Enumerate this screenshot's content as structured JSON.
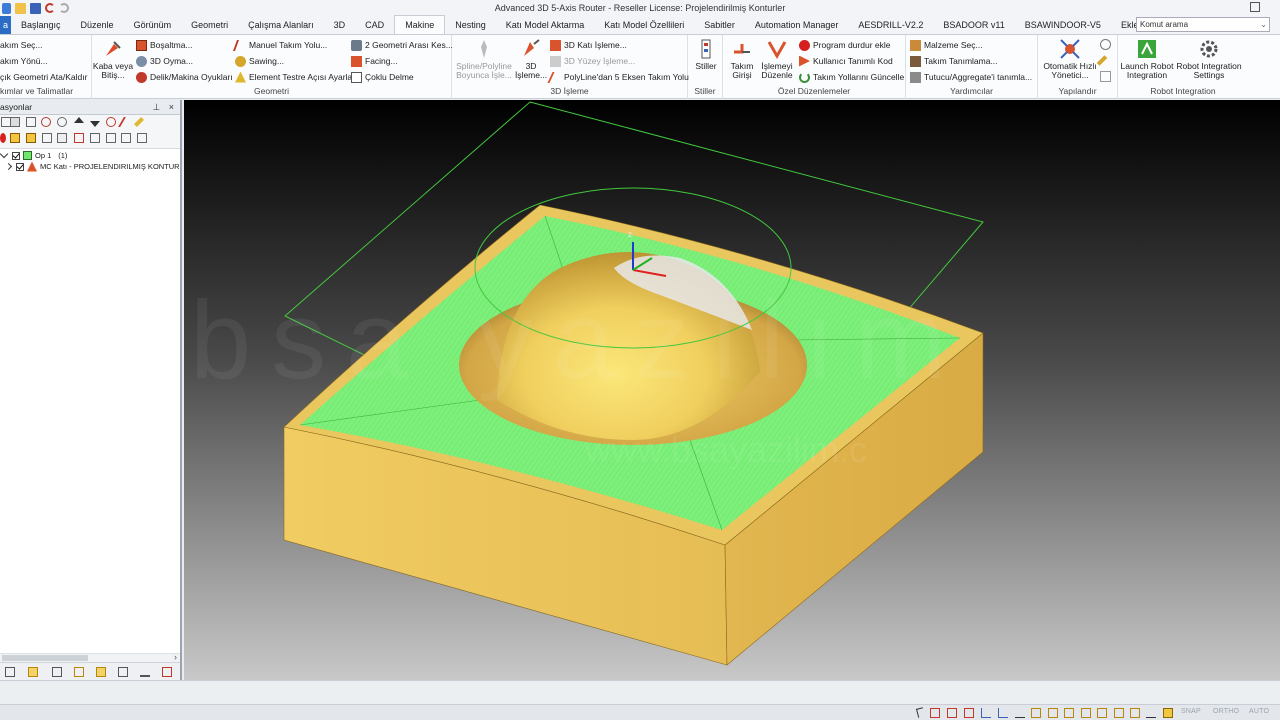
{
  "window": {
    "title": "Advanced 3D 5-Axis Router - Reseller License: Projelendirilmiş Konturler"
  },
  "tabs": [
    {
      "label": "a",
      "kind": "file"
    },
    {
      "label": "Başlangıç"
    },
    {
      "label": "Düzenle"
    },
    {
      "label": "Görünüm"
    },
    {
      "label": "Geometri"
    },
    {
      "label": "Çalışma Alanları"
    },
    {
      "label": "3D"
    },
    {
      "label": "CAD"
    },
    {
      "label": "Makine",
      "active": true
    },
    {
      "label": "Nesting"
    },
    {
      "label": "Katı Model Aktarma"
    },
    {
      "label": "Katı Model Özellileri"
    },
    {
      "label": "Sabitler"
    },
    {
      "label": "Automation Manager"
    },
    {
      "label": "AESDRILL-V2.2"
    },
    {
      "label": "BSADOOR v11"
    },
    {
      "label": "BSAWINDOOR-V5"
    },
    {
      "label": "Eklentiler/Makrolar"
    }
  ],
  "command_search": {
    "placeholder": "Komut arama"
  },
  "ribbon": {
    "group1": {
      "items": [
        "akım Seç...",
        "akım Yönü...",
        "çık Geometri Ata/Kaldır"
      ],
      "label": "kımlar ve Talimatlar"
    },
    "geometri": {
      "big_button": "Kaba veya\nBitiş...",
      "col1": [
        "Boşaltma...",
        "3D Oyma...",
        "Delik/Makina Oyukları"
      ],
      "col2": [
        "Manuel Takım Yolu...",
        "Sawing...",
        "Element Testre Açısı Ayarla"
      ],
      "col3": [
        "2 Geometri Arası Kes...",
        "Facing...",
        "Çoklu Delme"
      ],
      "label": "Geometri"
    },
    "islem3d": {
      "big1": "Spline/Polyline\nBoyunca İşle...",
      "big2": "3D\nİşleme...",
      "col": [
        "3D Katı İşleme...",
        "3D Yüzey İşleme...",
        "PolyLine'dan 5 Eksen Takım Yolu"
      ],
      "label": "3D İşleme"
    },
    "stiller": {
      "big": "Stiller",
      "label": "Stiller"
    },
    "ozel": {
      "big1": "Takım\nGirişi",
      "big2": "İşlemeyi\nDüzenle",
      "col": [
        "Program durdur ekle",
        "Kullanıcı Tanımlı Kod",
        "Takım Yollarını Güncelle"
      ],
      "label": "Özel Düzenlemeler"
    },
    "yardimcilar": {
      "col": [
        "Malzeme Seç...",
        "Takım Tanımlama...",
        "Tutucu/Aggregate'i tanımla..."
      ],
      "label": "Yardımcılar"
    },
    "yapilandir": {
      "big": "Otomatik Hızlı\nYönetici...",
      "label": "Yapılandır"
    },
    "robot": {
      "big1": "Launch Robot\nIntegration",
      "big2": "Robot Integration\nSettings",
      "label": "Robot Integration"
    }
  },
  "left_panel": {
    "title": "asyonlar",
    "pin": "⊥",
    "close": "×",
    "tree": [
      {
        "label": "Op 1",
        "extra": "(1)"
      },
      {
        "label": "MC Katı - PROJELENDIRILMIŞ KONTUR"
      }
    ]
  },
  "viewport": {
    "watermark": "bsa yazılım",
    "watermark_url": "www.bsayazilim.c",
    "axis_label": "z"
  },
  "status_bar": {
    "snap": "SNAP",
    "ortho": "ORTHO",
    "auto": "AUTO"
  },
  "colors": {
    "ribbon_active_tab": "#fbfcfd",
    "file_tab": "#2b6cc4",
    "part_body": "#e6c25a",
    "part_side": "#d7b046",
    "toolpath_green": "#7cf07a",
    "dome_highlight": "#f9e27a"
  }
}
